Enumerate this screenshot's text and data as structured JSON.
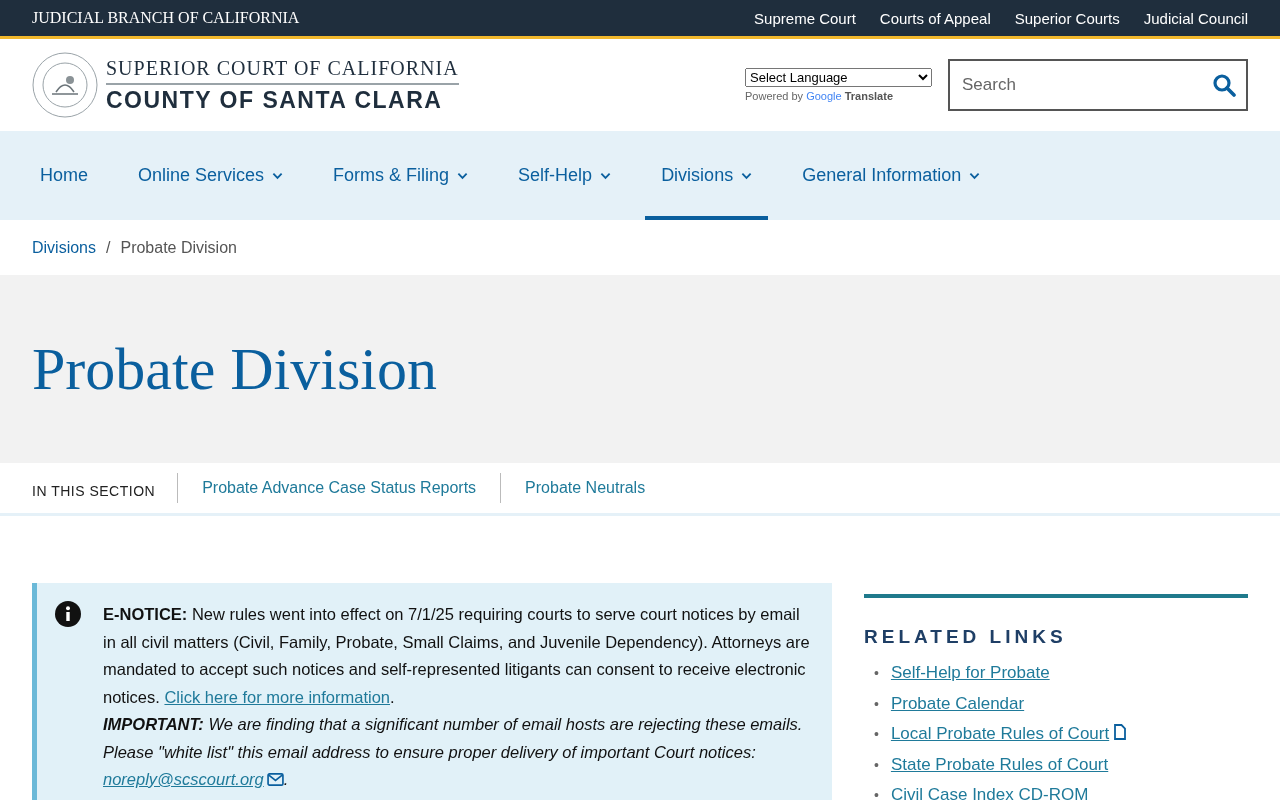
{
  "top_bar": {
    "title": "JUDICIAL BRANCH OF CALIFORNIA",
    "links": [
      "Supreme Court",
      "Courts of Appeal",
      "Superior Courts",
      "Judicial Council"
    ]
  },
  "header": {
    "logo_line1": "SUPERIOR COURT OF CALIFORNIA",
    "logo_line2": "COUNTY OF SANTA CLARA",
    "language_select": "Select Language",
    "powered_by": "Powered by",
    "google": "Google",
    "translate": "Translate",
    "search_placeholder": "Search"
  },
  "nav": [
    {
      "label": "Home",
      "has_dropdown": false,
      "selected": false
    },
    {
      "label": "Online Services",
      "has_dropdown": true,
      "selected": false
    },
    {
      "label": "Forms & Filing",
      "has_dropdown": true,
      "selected": false
    },
    {
      "label": "Self-Help",
      "has_dropdown": true,
      "selected": false
    },
    {
      "label": "Divisions",
      "has_dropdown": true,
      "selected": true
    },
    {
      "label": "General Information",
      "has_dropdown": true,
      "selected": false
    }
  ],
  "breadcrumb": [
    {
      "label": "Divisions",
      "kind": "link"
    },
    {
      "label": "Probate Division",
      "kind": "current"
    }
  ],
  "breadcrumb_separator": "/",
  "page_title": "Probate Division",
  "section_nav": {
    "label": "IN THIS SECTION",
    "links": [
      "Probate Advance Case Status Reports",
      "Probate Neutrals"
    ]
  },
  "notice": {
    "text": "**E-NOTICE:** New rules went into effect on 7/1/25 requiring courts to serve court notices by email in all civil matters (Civil, Family, Probate, Small Claims, and Juvenile Dependency). Attorneys are mandated to accept such notices and self-represented litigants can consent to receive electronic notices. ",
    "link": "Click here for more information",
    "after_link": ".",
    "important": "**IMPORTANT:** We are finding that a significant number of email hosts are rejecting these emails.  Please \"white list\" this email address to ensure proper delivery of important Court notices: ",
    "email": "noreply@scscourt.org",
    "after_email": "."
  },
  "related_links": {
    "title": "RELATED LINKS",
    "marker": "•",
    "items": [
      {
        "label": "Self-Help for Probate",
        "file_icon": false
      },
      {
        "label": "Probate Calendar",
        "file_icon": false
      },
      {
        "label": "Local Probate Rules of Court",
        "file_icon": true
      },
      {
        "label": "State Probate Rules of Court",
        "file_icon": false
      },
      {
        "label": "Civil Case Index CD-ROM",
        "file_icon": false
      }
    ]
  }
}
